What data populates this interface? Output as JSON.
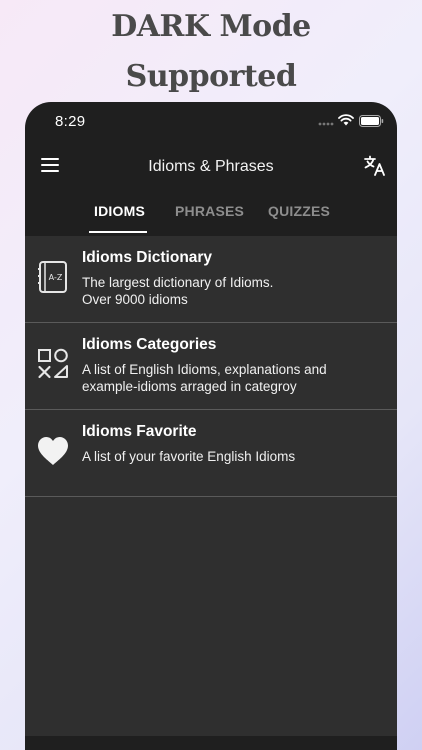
{
  "promo": {
    "line1": "DARK Mode",
    "line2": "Supported"
  },
  "status_bar": {
    "time": "8:29",
    "icons": [
      "signal-icon",
      "wifi-icon",
      "battery-icon"
    ]
  },
  "navbar": {
    "title": "Idioms & Phrases",
    "left_icon": "menu-icon",
    "right_icon": "translate-icon"
  },
  "tabs": [
    {
      "label": "IDIOMS",
      "active": true
    },
    {
      "label": "PHRASES",
      "active": false
    },
    {
      "label": "QUIZZES",
      "active": false
    }
  ],
  "items": [
    {
      "icon": "dictionary-icon",
      "title": "Idioms Dictionary",
      "desc_line1": "The largest dictionary of Idioms.",
      "desc_line2": "Over 9000 idioms"
    },
    {
      "icon": "categories-icon",
      "title": "Idioms Categories",
      "desc_line1": "A list of English Idioms, explanations and",
      "desc_line2": "example-idioms arraged in categroy"
    },
    {
      "icon": "heart-icon",
      "title": "Idioms Favorite",
      "desc_line1": "A list of your favorite English Idioms",
      "desc_line2": ""
    }
  ],
  "colors": {
    "background_dark": "#1f1f1f",
    "list_background": "#2f2f2f",
    "divider": "#5a5a5a",
    "active_tab": "#ffffff",
    "inactive_tab": "#8d8d8d"
  }
}
